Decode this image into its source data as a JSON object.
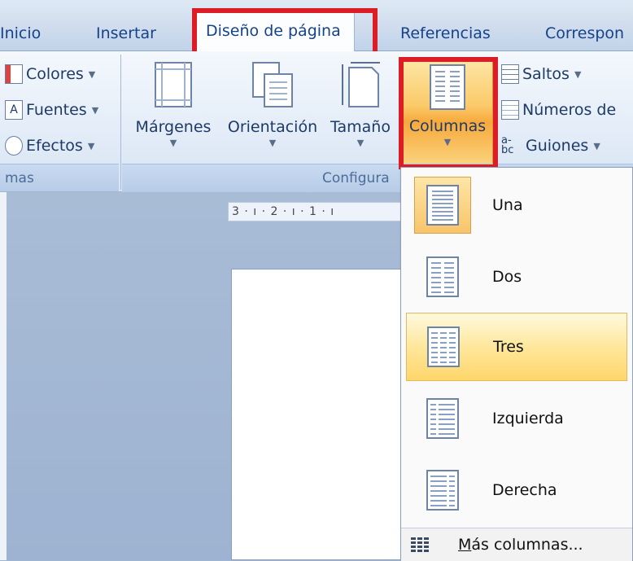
{
  "tabs": {
    "inicio": "Inicio",
    "insertar": "Insertar",
    "diseno": "Diseño de página",
    "referencias": "Referencias",
    "correspondencia": "Correspon"
  },
  "ribbon": {
    "themes": {
      "colores": "Colores",
      "fuentes": "Fuentes",
      "efectos": "Efectos",
      "group_title": "mas"
    },
    "page_setup": {
      "margenes": "Márgenes",
      "orientacion": "Orientación",
      "tamano": "Tamaño",
      "columnas": "Columnas",
      "saltos": "Saltos",
      "numeros": "Números de",
      "guiones": "Guiones",
      "group_title": "Configura"
    }
  },
  "ruler": {
    "text": "3 · ı · 2 · ı · 1 · ı"
  },
  "columns_menu": {
    "items": [
      {
        "label": "Una"
      },
      {
        "label": "Dos"
      },
      {
        "label": "Tres"
      },
      {
        "label": "Izquierda"
      },
      {
        "label": "Derecha"
      }
    ],
    "more": "Más columnas..."
  },
  "colors": {
    "highlight": "#dd1d26",
    "tab_text": "#15428b",
    "hover": "#ffd66b"
  }
}
